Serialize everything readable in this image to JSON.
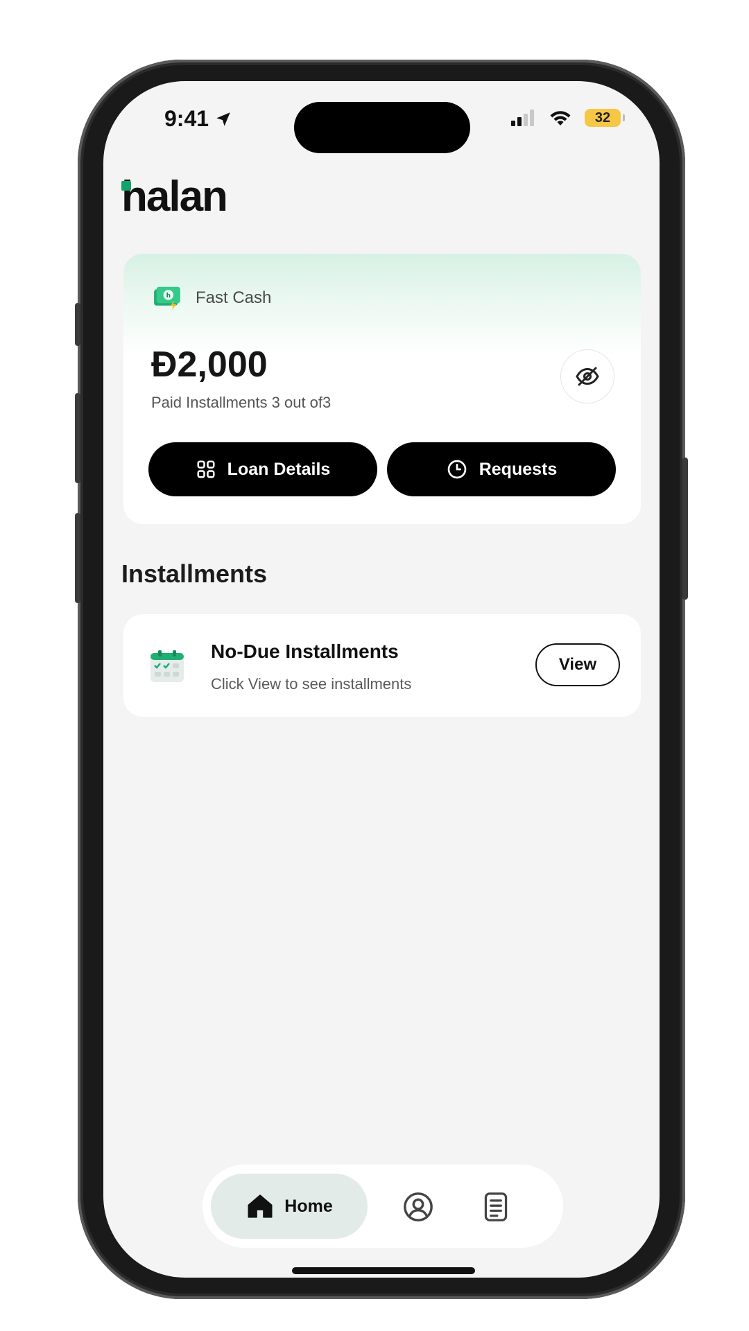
{
  "status_bar": {
    "time": "9:41",
    "battery": "32",
    "icons": [
      "location-arrow-icon",
      "signal-icon",
      "wifi-icon",
      "battery-icon"
    ]
  },
  "app": {
    "logo_text": "halan",
    "brand_color": "#12a36a"
  },
  "loan_card": {
    "product_name": "Fast Cash",
    "amount": "Ð2,000",
    "paid_text": "Paid Installments 3 out of3",
    "buttons": {
      "loan_details": "Loan Details",
      "requests": "Requests"
    },
    "icons": [
      "cash-icon",
      "eye-off-icon",
      "grid-icon",
      "clock-icon"
    ]
  },
  "installments": {
    "section_title": "Installments",
    "card_title": "No-Due Installments",
    "card_subtitle": "Click View to see installments",
    "view_label": "View",
    "icons": [
      "calendar-check-icon"
    ]
  },
  "bottom_nav": {
    "home_label": "Home",
    "active": "Home",
    "items": [
      "home-icon",
      "profile-icon",
      "document-icon"
    ]
  }
}
